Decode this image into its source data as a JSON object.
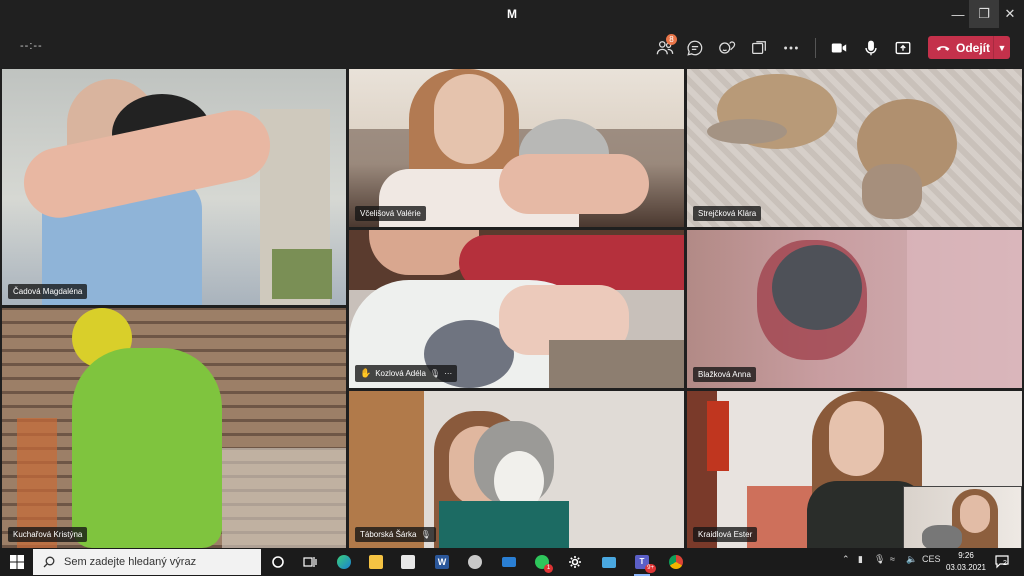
{
  "window": {
    "title": "M"
  },
  "toolbar": {
    "timer": "--:--",
    "participants_badge": "8",
    "leave_label": "Odejít"
  },
  "tiles": [
    {
      "name": "Čadová Magdaléna"
    },
    {
      "name": "Včelišová Valérie"
    },
    {
      "name": "Strejčková Klára"
    },
    {
      "name": "Kozlová Adéla"
    },
    {
      "name": "Blažková Anna"
    },
    {
      "name": "Kuchařová Kristýna"
    },
    {
      "name": "Táborská Šárka"
    },
    {
      "name": "Kraidlová Ester"
    }
  ],
  "taskbar": {
    "search_placeholder": "Sem zadejte hledaný výraz",
    "language": "CES",
    "time": "9:26",
    "date": "03.03.2021",
    "notification_count": "2",
    "whatsapp_badge": "1",
    "teams_badge": "9+"
  },
  "colors": {
    "leave": "#c4314b",
    "background": "#1f1f1f",
    "taskbar": "#1b1b1b"
  }
}
